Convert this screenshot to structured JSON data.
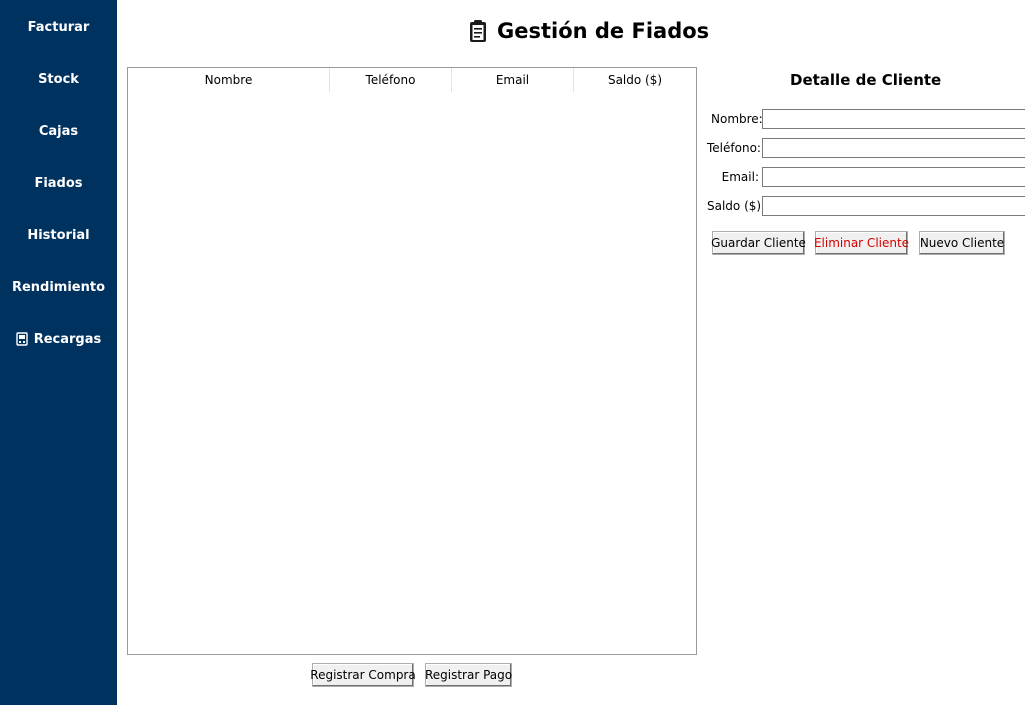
{
  "sidebar": {
    "items": [
      {
        "label": "Facturar"
      },
      {
        "label": "Stock"
      },
      {
        "label": "Cajas"
      },
      {
        "label": "Fiados"
      },
      {
        "label": "Historial"
      },
      {
        "label": "Rendimiento"
      },
      {
        "label": "Recargas",
        "icon": "recharge-icon"
      }
    ],
    "background": "#00325f"
  },
  "header": {
    "title": "Gestión de Fiados",
    "icon": "clipboard-icon"
  },
  "table": {
    "columns": [
      "Nombre",
      "Teléfono",
      "Email",
      "Saldo ($)"
    ],
    "rows": []
  },
  "actions": {
    "register_purchase": "Registrar Compra",
    "register_payment": "Registrar Pago"
  },
  "detail": {
    "title": "Detalle de Cliente",
    "fields": {
      "name": {
        "label": "Nombre:",
        "value": ""
      },
      "phone": {
        "label": "Teléfono:",
        "value": ""
      },
      "email": {
        "label": "Email:",
        "value": ""
      },
      "balance": {
        "label": "Saldo ($):",
        "value": ""
      }
    },
    "buttons": {
      "save": "Guardar Cliente",
      "delete": "Eliminar Cliente",
      "new": "Nuevo Cliente"
    },
    "delete_color": "#d40000"
  }
}
